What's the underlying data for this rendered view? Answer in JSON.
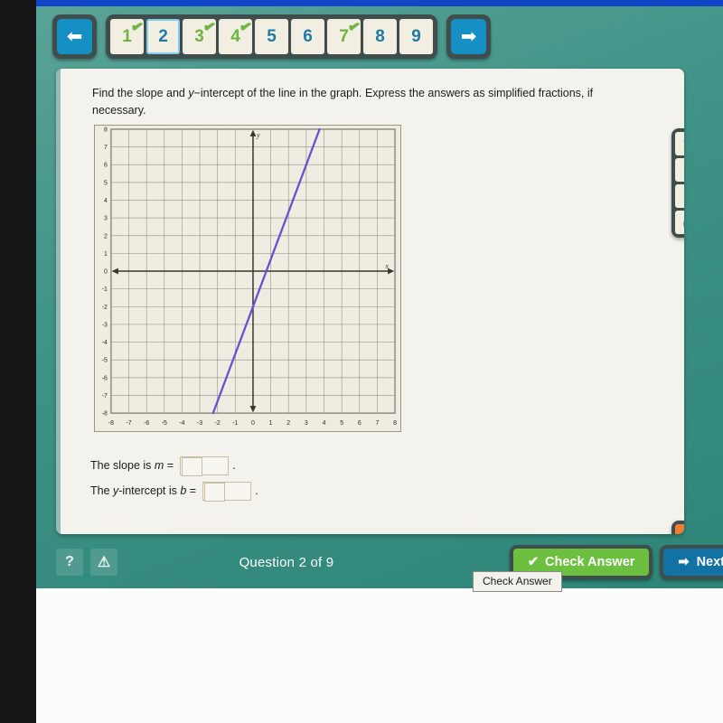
{
  "nav": {
    "prev_icon": "left-arrow-icon",
    "next_icon": "right-arrow-icon",
    "questions": [
      {
        "num": "1",
        "state": "done",
        "check": "✔"
      },
      {
        "num": "2",
        "state": "current",
        "check": ""
      },
      {
        "num": "3",
        "state": "done",
        "check": "✔"
      },
      {
        "num": "4",
        "state": "done",
        "check": "✔"
      },
      {
        "num": "5",
        "state": "todo",
        "check": ""
      },
      {
        "num": "6",
        "state": "todo",
        "check": ""
      },
      {
        "num": "7",
        "state": "done",
        "check": "✔"
      },
      {
        "num": "8",
        "state": "todo",
        "check": ""
      },
      {
        "num": "9",
        "state": "todo",
        "check": ""
      }
    ]
  },
  "question": {
    "text_part1": "Find the slope and ",
    "text_italic_y": "y",
    "text_part2": "−intercept of the line in the graph. Express the answers as simplified fractions, if necessary."
  },
  "answers": {
    "slope_label_pre": "The slope is ",
    "slope_label_var": "m",
    "slope_label_post": " =",
    "slope_value": "",
    "slope_placeholder": "",
    "slope_period": ".",
    "intercept_label_pre": "The ",
    "intercept_label_var_y": "y",
    "intercept_label_mid": "-intercept is ",
    "intercept_label_var_b": "b",
    "intercept_label_post": " =",
    "intercept_value": "",
    "intercept_placeholder": "",
    "intercept_period": "."
  },
  "toolbar_top": [
    {
      "icon": "hand-pointer-icon",
      "glyph": "☚"
    },
    {
      "icon": "person-icon",
      "glyph": "♟"
    },
    {
      "icon": "book-icon",
      "glyph": "■"
    },
    {
      "icon": "printer-icon",
      "glyph": "⎙"
    }
  ],
  "toolbar_bottom": [
    {
      "icon": "document-add-icon",
      "glyph": "⎘"
    },
    {
      "icon": "save-disk-icon",
      "glyph": "▣"
    }
  ],
  "footer": {
    "help_icon": "question-mark-icon",
    "help_label": "?",
    "warning_icon": "warning-triangle-icon",
    "warning_label": "⚠",
    "question_counter": "Question 2 of 9",
    "check_answer_label": "Check Answer",
    "check_answer_icon": "checkmark-icon",
    "check_answer_glyph": "✔",
    "next_label": "Next",
    "next_icon": "right-arrow-icon",
    "next_glyph": "➡",
    "tooltip_text": "Check Answer"
  },
  "colors": {
    "app_teal": "#3f9387",
    "accent_blue": "#1272a3",
    "accent_green": "#6cbf3f",
    "accent_orange": "#f08030",
    "line_purple": "#6a4fd0",
    "grid_gray": "#8b8276"
  },
  "chart_data": {
    "type": "line",
    "title": "",
    "xlabel": "x",
    "ylabel": "y",
    "xlim": [
      -8,
      8
    ],
    "ylim": [
      -8,
      8
    ],
    "grid": true,
    "xticks": [
      -8,
      -7,
      -6,
      -5,
      -4,
      -3,
      -2,
      -1,
      0,
      1,
      2,
      3,
      4,
      5,
      6,
      7,
      8
    ],
    "yticks": [
      8,
      7,
      6,
      5,
      4,
      3,
      2,
      1,
      0,
      -1,
      -2,
      -3,
      -4,
      -5,
      -6,
      -7,
      -8
    ],
    "series": [
      {
        "name": "line",
        "color": "#6a4fd0",
        "slope": 2.6667,
        "intercept": -2,
        "points": [
          [
            -2.25,
            -8
          ],
          [
            0,
            -2
          ],
          [
            3.75,
            8
          ]
        ]
      }
    ],
    "axis_arrow_labels": {
      "x": "x",
      "y": "y"
    }
  }
}
